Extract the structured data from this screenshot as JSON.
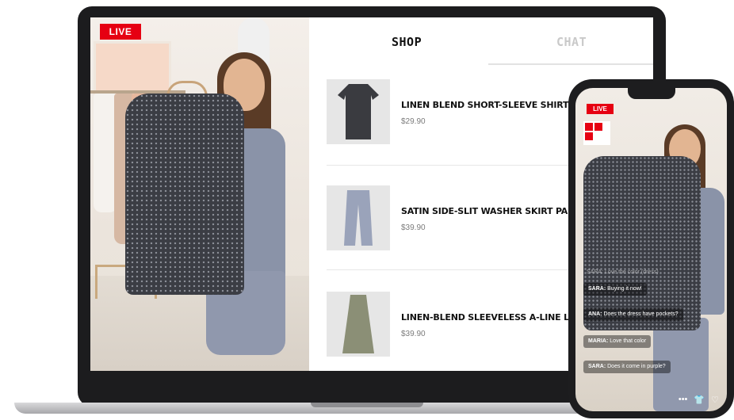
{
  "laptop": {
    "live_badge": "LIVE",
    "tabs": {
      "shop": "SHOP",
      "chat": "CHAT"
    },
    "products": [
      {
        "name": "LINEN BLEND SHORT-SLEEVE SHIRT",
        "price": "$29.90",
        "color": "#3a3b40"
      },
      {
        "name": "SATIN SIDE-SLIT WASHER SKIRT PANT",
        "price": "$39.90",
        "color": "#9aa3ba"
      },
      {
        "name": "LINEN-BLEND SLEEVELESS A-LINE LO",
        "price": "$39.90",
        "color": "#8b8f76"
      }
    ]
  },
  "phone": {
    "live_badge": "LIVE",
    "faded_message": "SARA: Love the color (dress)",
    "chat": [
      {
        "user": "SARA:",
        "text": "Buying it now!"
      },
      {
        "user": "ANA:",
        "text": "Does the dress have pockets?"
      },
      {
        "user": "MARIA:",
        "text": "Love that color"
      },
      {
        "user": "SARA:",
        "text": "Does it come in purple?"
      }
    ],
    "icons": {
      "more": "•••",
      "shirt": "👕",
      "heart": "♡"
    }
  },
  "colors": {
    "live_red": "#e60012",
    "bezel": "#1c1c1e"
  }
}
